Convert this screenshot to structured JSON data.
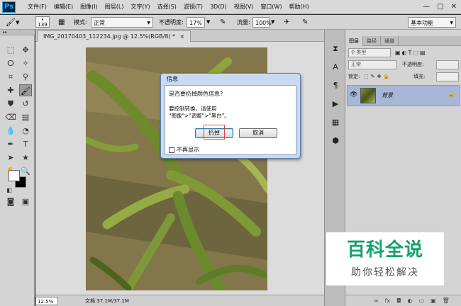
{
  "app": {
    "logo": "Ps"
  },
  "menu": [
    "文件(F)",
    "编辑(E)",
    "图像(I)",
    "图层(L)",
    "文字(Y)",
    "选择(S)",
    "滤镜(T)",
    "3D(D)",
    "视图(V)",
    "窗口(W)",
    "帮助(H)"
  ],
  "window_controls": {
    "minimize": "—",
    "maximize": "□",
    "close": "✕"
  },
  "options": {
    "brush_size": "139",
    "mode_label": "模式:",
    "mode_value": "正常",
    "opacity_label": "不透明度:",
    "opacity_value": "17%",
    "flow_label": "流量:",
    "flow_value": "100%",
    "workspace": "基本功能"
  },
  "document": {
    "tab": "IMG_20170403_112234.jpg @ 12.5%(RGB/8) *",
    "tab_close": "×",
    "zoom": "12.5%",
    "doc_size": "文档:37.1M/37.1M"
  },
  "layers_panel": {
    "tabs": [
      "图层",
      "路径",
      "通道"
    ],
    "filter_label": "类型",
    "blend_mode": "正常",
    "opacity_label": "不透明度:",
    "lock_label": "锁定:",
    "fill_label": "填充:",
    "layer_name": "背景",
    "bottom_icons": [
      "∞",
      "fx",
      "◘",
      "◐",
      "▭",
      "▣",
      "🗑"
    ]
  },
  "dialog": {
    "title": "信息",
    "question": "是否要扔掉颜色信息?",
    "info_line1": "要控制转换，请使用",
    "info_line2": "\"图像\">\"调整\">\"黑白\"。",
    "discard_button": "扔掉",
    "cancel_button": "取消",
    "dont_show": "不再显示"
  },
  "watermark": {
    "title": "百科全说",
    "subtitle": "助你轻松解决"
  }
}
